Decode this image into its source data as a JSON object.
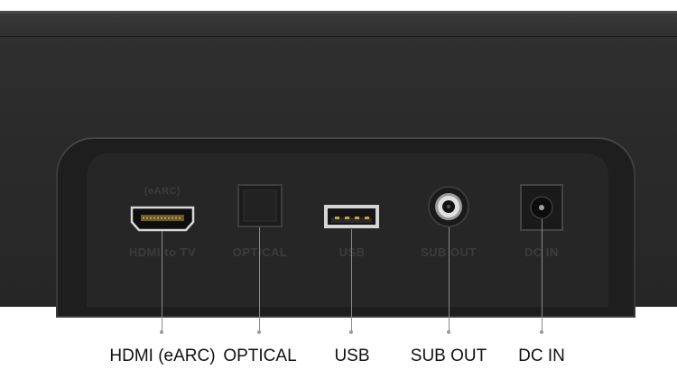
{
  "panel_markings": {
    "earc": "(eARC)",
    "hdmi_to_tv": "HDMI to TV",
    "optical": "OPTICAL",
    "usb": "USB",
    "sub_out": "SUB OUT",
    "dc_in": "DC IN"
  },
  "callouts": [
    {
      "label": "HDMI (eARC)"
    },
    {
      "label": "OPTICAL"
    },
    {
      "label": "USB"
    },
    {
      "label": "SUB OUT"
    },
    {
      "label": "DC IN"
    }
  ],
  "colors": {
    "device_body": "#2b2b2b",
    "port_panel": "#262626",
    "leader_line": "#8a8a8a",
    "callout_text": "#111111"
  }
}
